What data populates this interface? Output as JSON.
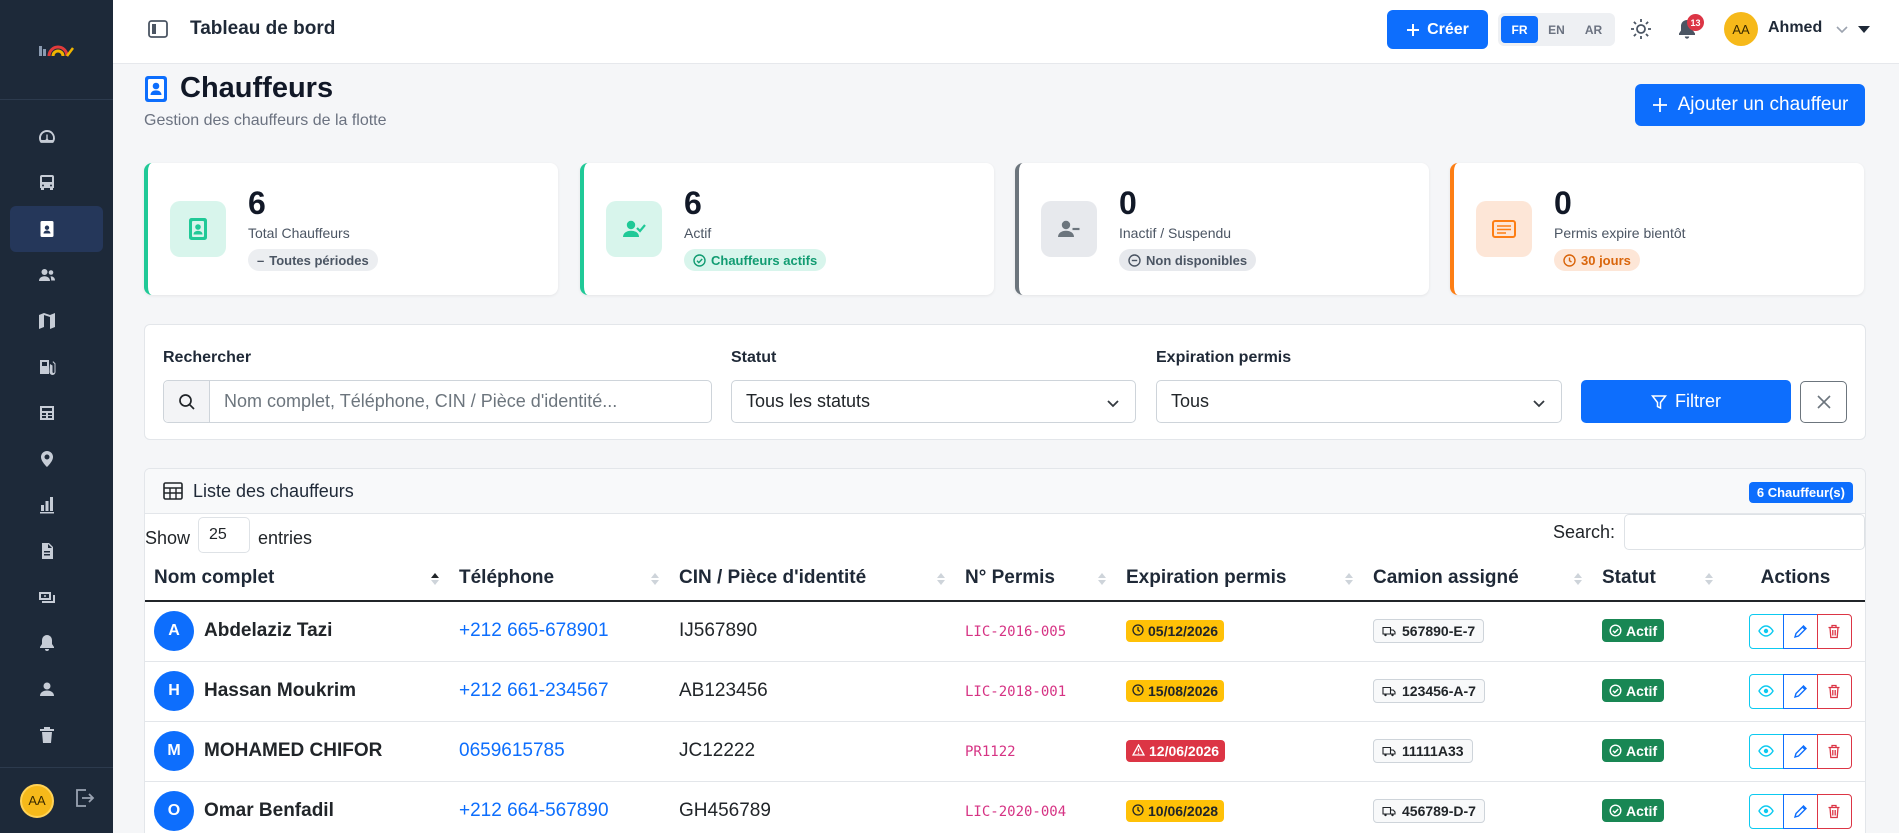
{
  "topbar": {
    "title": "Tableau de bord",
    "create_label": "Créer",
    "languages": [
      "FR",
      "EN",
      "AR"
    ],
    "active_language": "FR",
    "notif_count": "13",
    "user_initials": "AA",
    "user_name": "Ahmed"
  },
  "sidebar": {
    "items": [
      "dashboard-icon",
      "bus-icon",
      "id-badge-icon",
      "users-icon",
      "map-icon",
      "fuel-icon",
      "receipt-icon",
      "location-pin-icon",
      "chart-icon",
      "document-icon",
      "money-icon",
      "bell-icon",
      "user-icon",
      "trash-icon"
    ],
    "active_index": 2,
    "user_initials": "AA"
  },
  "page": {
    "title": "Chauffeurs",
    "subtitle": "Gestion des chauffeurs de la flotte",
    "add_label": "Ajouter un chauffeur"
  },
  "stats": [
    {
      "value": "6",
      "label": "Total Chauffeurs",
      "pill": "Toutes périodes",
      "color": "#20c997"
    },
    {
      "value": "6",
      "label": "Actif",
      "pill": "Chauffeurs actifs",
      "color": "#20c997"
    },
    {
      "value": "0",
      "label": "Inactif / Suspendu",
      "pill": "Non disponibles",
      "color": "#6c757d"
    },
    {
      "value": "0",
      "label": "Permis expire bientôt",
      "pill": "30 jours",
      "color": "#fd7e14"
    }
  ],
  "filters": {
    "search_label": "Rechercher",
    "search_placeholder": "Nom complet, Téléphone, CIN / Pièce d'identité...",
    "status_label": "Statut",
    "status_value": "Tous les statuts",
    "expiry_label": "Expiration permis",
    "expiry_value": "Tous",
    "filter_label": "Filtrer"
  },
  "list": {
    "title": "Liste des chauffeurs",
    "count_badge": "6 Chauffeur(s)",
    "show_label": "Show",
    "entries_value": "25",
    "entries_label": "entries",
    "search_label": "Search:",
    "columns": [
      "Nom complet",
      "Téléphone",
      "CIN / Pièce d'identité",
      "N° Permis",
      "Expiration permis",
      "Camion assigné",
      "Statut",
      "Actions"
    ],
    "rows": [
      {
        "initial": "A",
        "name": "Abdelaziz Tazi",
        "phone": "+212 665-678901",
        "cin": "IJ567890",
        "permis": "LIC-2016-005",
        "expiry": "05/12/2026",
        "expiry_level": "warn",
        "truck": "567890-E-7",
        "status": "Actif"
      },
      {
        "initial": "H",
        "name": "Hassan Moukrim",
        "phone": "+212 661-234567",
        "cin": "AB123456",
        "permis": "LIC-2018-001",
        "expiry": "15/08/2026",
        "expiry_level": "warn",
        "truck": "123456-A-7",
        "status": "Actif"
      },
      {
        "initial": "M",
        "name": "MOHAMED CHIFOR",
        "phone": "0659615785",
        "cin": "JC12222",
        "permis": "PR1122",
        "expiry": "12/06/2026",
        "expiry_level": "danger",
        "truck": "11111A33",
        "status": "Actif"
      },
      {
        "initial": "O",
        "name": "Omar Benfadil",
        "phone": "+212 664-567890",
        "cin": "GH456789",
        "permis": "LIC-2020-004",
        "expiry": "10/06/2028",
        "expiry_level": "warn",
        "truck": "456789-D-7",
        "status": "Actif"
      }
    ]
  }
}
